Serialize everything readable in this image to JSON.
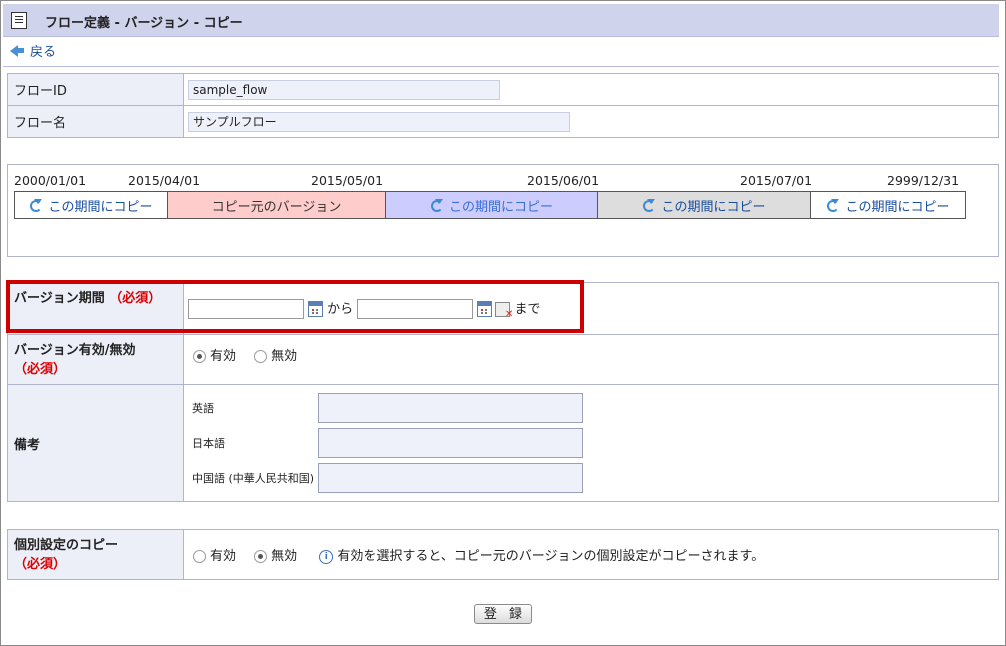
{
  "header": {
    "title": "フロー定義 - バージョン - コピー",
    "back_label": "戻る"
  },
  "flow": {
    "id_label": "フローID",
    "id_value": "sample_flow",
    "name_label": "フロー名",
    "name_value": "サンプルフロー"
  },
  "timeline": {
    "dates": [
      "2000/01/01",
      "2015/04/01",
      "2015/05/01",
      "2015/06/01",
      "2015/07/01",
      "2999/12/31"
    ],
    "segments": [
      {
        "label": "この期間にコピー",
        "kind": "copy",
        "bg": "#ffffff",
        "color": "#1a4fa0"
      },
      {
        "label": "コピー元のバージョン",
        "kind": "source",
        "bg": "#ffcccc",
        "color": "#333333"
      },
      {
        "label": "この期間にコピー",
        "kind": "copy",
        "bg": "#ccccff",
        "color": "#3a6fd8"
      },
      {
        "label": "この期間にコピー",
        "kind": "copy",
        "bg": "#dddddd",
        "color": "#1a4fa0"
      },
      {
        "label": "この期間にコピー",
        "kind": "copy",
        "bg": "#ffffff",
        "color": "#1a4fa0"
      }
    ]
  },
  "period": {
    "label": "バージョン期間",
    "required": "（必須）",
    "from_text": "から",
    "to_text": "まで",
    "from_value": "",
    "to_value": ""
  },
  "validity": {
    "label": "バージョン有効/無効",
    "required": "（必須）",
    "options": [
      "有効",
      "無効"
    ],
    "selected": "有効"
  },
  "notes": {
    "label": "備考",
    "langs": [
      "英語",
      "日本語",
      "中国語 (中華人民共和国)"
    ]
  },
  "individual": {
    "label": "個別設定のコピー",
    "required": "（必須）",
    "options": [
      "有効",
      "無効"
    ],
    "selected": "無効",
    "info": "有効を選択すると、コピー元のバージョンの個別設定がコピーされます。"
  },
  "submit_label": "登 録",
  "colors": {
    "highlight": "#cc0000",
    "label_bg": "#eceef8",
    "title_bg": "#cfd3ec"
  }
}
